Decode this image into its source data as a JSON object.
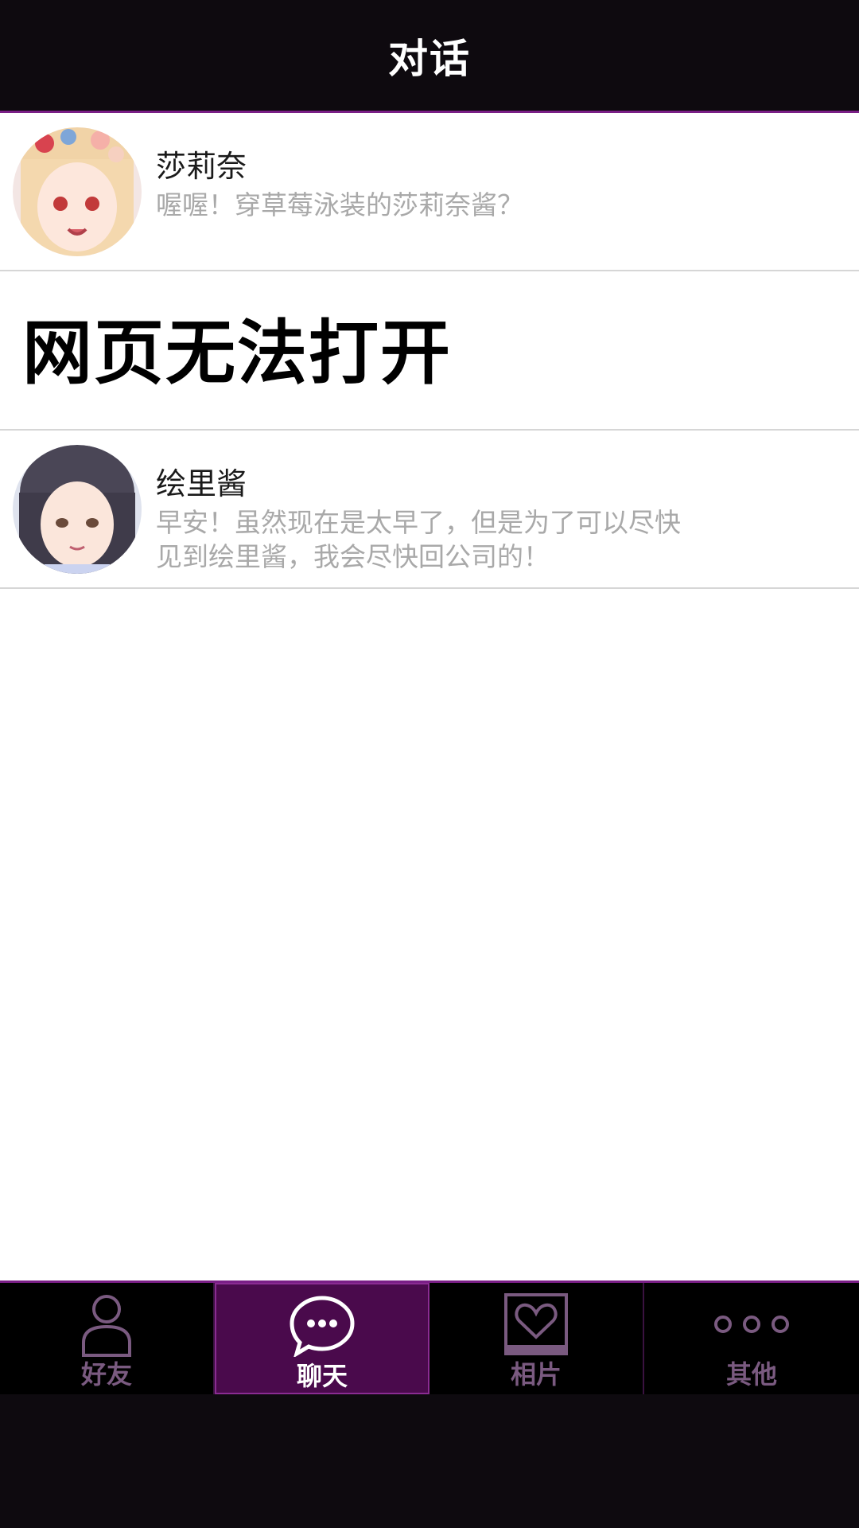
{
  "header": {
    "title": "对话"
  },
  "conversations": [
    {
      "name": "莎莉奈",
      "message": "喔喔！穿草莓泳装的莎莉奈酱？"
    },
    {
      "error": "网页无法打开"
    },
    {
      "name": "绘里酱",
      "message": "早安！虽然现在是太早了，但是为了可以尽快见到绘里酱，我会尽快回公司的！"
    }
  ],
  "tabs": [
    {
      "label": "好友",
      "icon": "person-icon",
      "active": false
    },
    {
      "label": "聊天",
      "icon": "chat-bubble-icon",
      "active": true
    },
    {
      "label": "相片",
      "icon": "photo-heart-icon",
      "active": false
    },
    {
      "label": "其他",
      "icon": "more-dots-icon",
      "active": false
    }
  ],
  "colors": {
    "accent": "#7a1f86",
    "active_tab": "#4a0a4c",
    "inactive_label": "#7a5a80",
    "message_gray": "#a9a9a9"
  }
}
